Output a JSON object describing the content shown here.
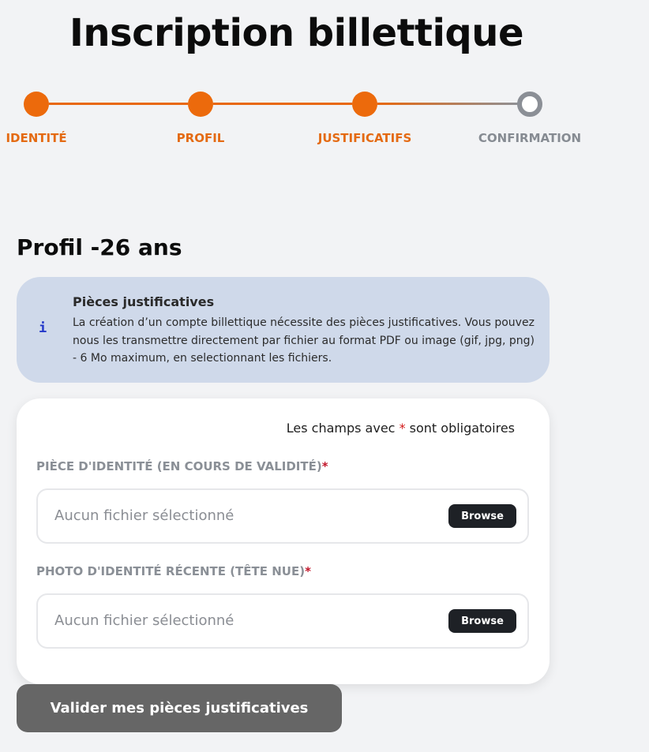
{
  "page": {
    "title": "Inscription billettique"
  },
  "stepper": {
    "steps": [
      {
        "label": "IDENTITÉ",
        "status": "completed"
      },
      {
        "label": "PROFIL",
        "status": "completed"
      },
      {
        "label": "JUSTIFICATIFS",
        "status": "current"
      },
      {
        "label": "CONFIRMATION",
        "status": "pending"
      }
    ],
    "active_color": "#e8680f",
    "pending_color": "#8b8f96"
  },
  "section": {
    "title": "Profil -26 ans"
  },
  "info": {
    "icon": "info-icon",
    "icon_glyph": "i",
    "title": "Pièces justificatives",
    "text": "La création d’un compte billettique nécessite des pièces justificatives. Vous pouvez nous les transmettre directement par fichier au format PDF ou image (gif, jpg, png) - 6 Mo maximum, en selectionnant les fichiers."
  },
  "form": {
    "required_note_before": "Les champs avec",
    "required_marker": "*",
    "required_note_after": "sont obligatoires",
    "fields": [
      {
        "label": "PIÈCE D'IDENTITÉ (EN COURS DE VALIDITÉ)",
        "required_marker": "*",
        "placeholder": "Aucun fichier sélectionné",
        "button_label": "Browse"
      },
      {
        "label": "PHOTO D'IDENTITÉ RÉCENTE (TÊTE NUE)",
        "required_marker": "*",
        "placeholder": "Aucun fichier sélectionné",
        "button_label": "Browse"
      }
    ],
    "submit_label": "Valider mes pièces justificatives"
  }
}
